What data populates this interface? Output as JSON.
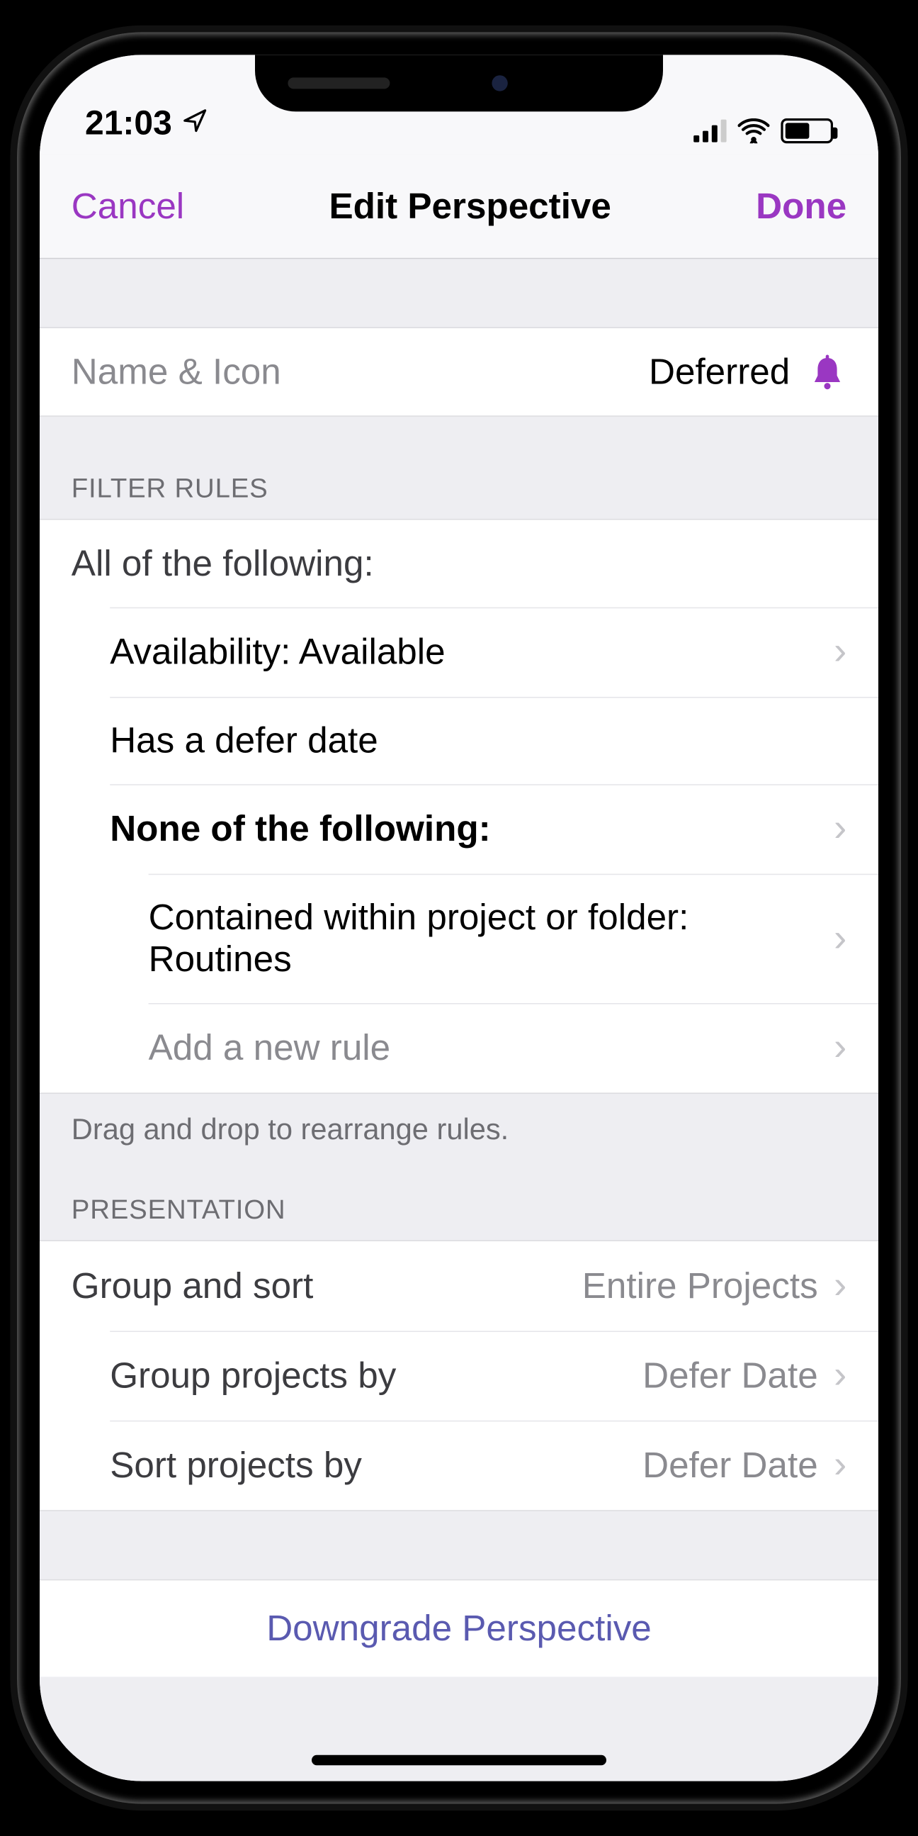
{
  "status": {
    "time": "21:03"
  },
  "navbar": {
    "cancel": "Cancel",
    "title": "Edit Perspective",
    "done": "Done"
  },
  "name_icon": {
    "label": "Name & Icon",
    "value": "Deferred",
    "icon_color": "#9a37c2"
  },
  "filter": {
    "header": "FILTER RULES",
    "root_label": "All of the following:",
    "rule_availability": "Availability: Available",
    "rule_defer": "Has a defer date",
    "none_label": "None of the following:",
    "rule_contained": "Contained within project or folder: Routines",
    "add_rule": "Add a new rule",
    "footnote": "Drag and drop to rearrange rules."
  },
  "presentation": {
    "header": "PRESENTATION",
    "group_sort_label": "Group and sort",
    "group_sort_value": "Entire Projects",
    "group_by_label": "Group projects by",
    "group_by_value": "Defer Date",
    "sort_by_label": "Sort projects by",
    "sort_by_value": "Defer Date"
  },
  "downgrade": "Downgrade Perspective"
}
